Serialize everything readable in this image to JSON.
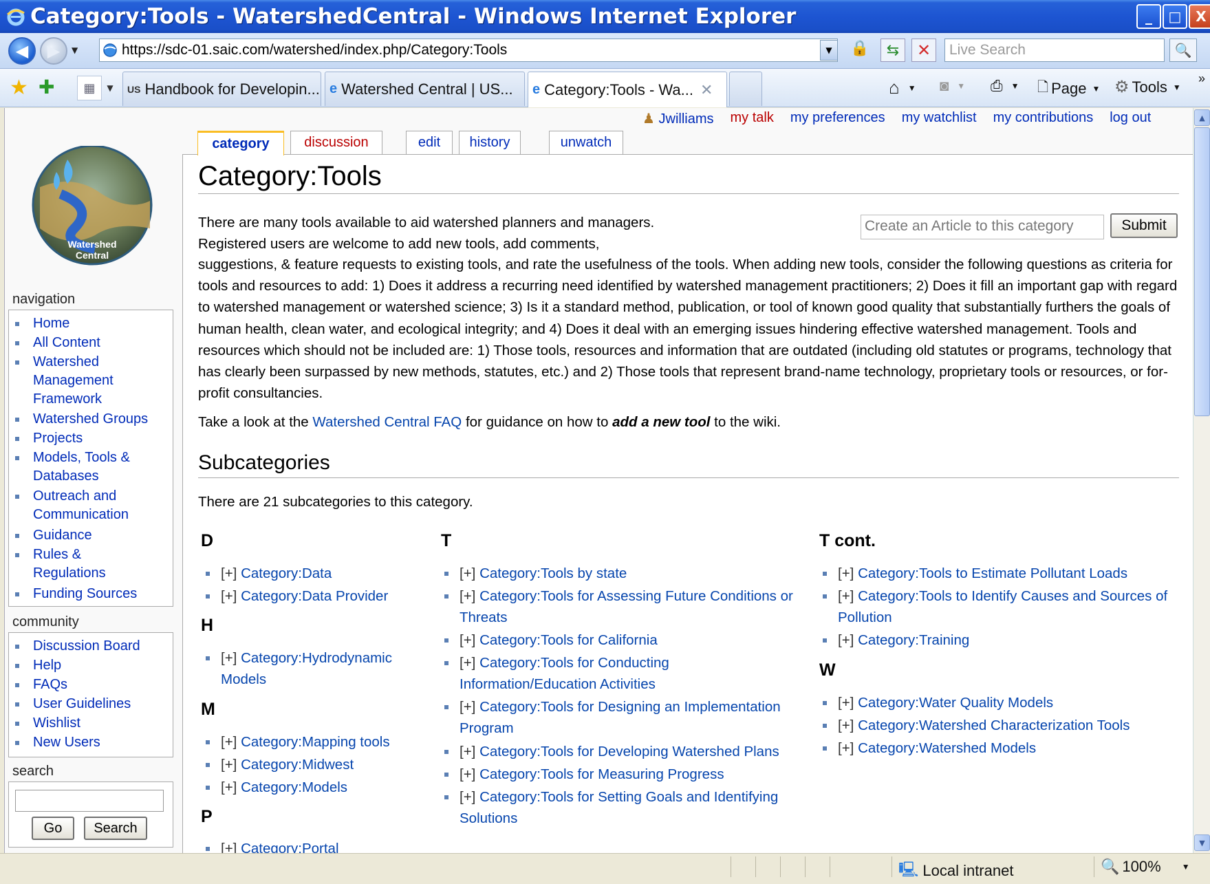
{
  "window": {
    "title": "Category:Tools - WatershedCentral - Windows Internet Explorer",
    "min": "_",
    "max": "□",
    "close": "X"
  },
  "address_bar": {
    "url": "https://sdc-01.saic.com/watershed/index.php/Category:Tools",
    "search_placeholder": "Live Search"
  },
  "browser_tabs": [
    {
      "label": "Handbook for Developin...",
      "icon": "epa-icon"
    },
    {
      "label": "Watershed Central | US...",
      "icon": "ie-icon"
    },
    {
      "label": "Category:Tools - Wa...",
      "icon": "ie-icon",
      "active": true
    }
  ],
  "commands": {
    "page": "Page",
    "tools": "Tools",
    "more": "»"
  },
  "userbar": {
    "user": "Jwilliams",
    "talk": "my talk",
    "preferences": "my preferences",
    "watchlist": "my watchlist",
    "contributions": "my contributions",
    "logout": "log out"
  },
  "logo_text": [
    "Watershed",
    "Central"
  ],
  "page_tabs": {
    "category": "category",
    "discussion": "discussion",
    "edit": "edit",
    "history": "history",
    "unwatch": "unwatch"
  },
  "page": {
    "title": "Category:Tools",
    "create_placeholder": "Create an Article to this category",
    "submit": "Submit",
    "intro_line1": "There are many tools available to aid watershed planners and managers.",
    "intro_line2": "Registered users are welcome to add new tools, add comments,",
    "intro_rest": "suggestions, & feature requests to existing tools, and rate the usefulness of the tools. When adding new tools, consider the following questions as criteria for tools and resources to add: 1) Does it address a recurring need identified by watershed management practitioners; 2) Does it fill an important gap with regard to watershed management or watershed science; 3) Is it a standard method, publication, or tool of known good quality that substantially furthers the goals of human health, clean water, and ecological integrity; and 4) Does it deal with an emerging issues hindering effective watershed management. Tools and resources which should not be included are: 1) Those tools, resources and information that are outdated (including old statutes or programs, technology that has clearly been surpassed by new methods, statutes, etc.) and 2) Those tools that represent brand-name technology, proprietary tools or resources, or for-profit consultancies.",
    "faq_pre": "Take a look at the ",
    "faq_link": "Watershed Central FAQ",
    "faq_mid": " for guidance on how to ",
    "faq_bold": "add a new tool",
    "faq_post": " to the wiki.",
    "subcat_heading": "Subcategories",
    "subcat_count": "There are 21 subcategories to this category."
  },
  "subcategories": {
    "expander": "[+]",
    "col1": [
      {
        "letter": "D",
        "items": [
          "Category:Data",
          "Category:Data Provider"
        ]
      },
      {
        "letter": "H",
        "items": [
          "Category:Hydrodynamic Models"
        ]
      },
      {
        "letter": "M",
        "items": [
          "Category:Mapping tools",
          "Category:Midwest",
          "Category:Models"
        ]
      },
      {
        "letter": "P",
        "items": [
          "Category:Portal"
        ]
      }
    ],
    "col2": [
      {
        "letter": "T",
        "items": [
          "Category:Tools by state",
          "Category:Tools for Assessing Future Conditions or Threats",
          "Category:Tools for California",
          "Category:Tools for Conducting Information/Education Activities",
          "Category:Tools for Designing an Implementation Program",
          "Category:Tools for Developing Watershed Plans",
          "Category:Tools for Measuring Progress",
          "Category:Tools for Setting Goals and Identifying Solutions"
        ]
      }
    ],
    "col3": [
      {
        "letter": "T cont.",
        "items": [
          "Category:Tools to Estimate Pollutant Loads",
          "Category:Tools to Identify Causes and Sources of Pollution",
          "Category:Training"
        ]
      },
      {
        "letter": "W",
        "items": [
          "Category:Water Quality Models",
          "Category:Watershed Characterization Tools",
          "Category:Watershed Models"
        ]
      }
    ]
  },
  "sidebar": {
    "navigation_title": "navigation",
    "navigation": [
      "Home",
      "All Content",
      "Watershed Management Framework",
      "Watershed Groups",
      "Projects",
      "Models, Tools & Databases",
      "Outreach and Communication",
      "Guidance",
      "Rules & Regulations",
      "Funding Sources"
    ],
    "community_title": "community",
    "community": [
      "Discussion Board",
      "Help",
      "FAQs",
      "User Guidelines",
      "Wishlist",
      "New Users"
    ],
    "search_title": "search",
    "go": "Go",
    "search": "Search"
  },
  "statusbar": {
    "zone": "Local intranet",
    "zoom": "100%"
  },
  "colors": {
    "link": "#0645ad",
    "new_link": "#ba0000",
    "tab_selected": "#fabd23",
    "titlebar": "#1d55d2"
  }
}
